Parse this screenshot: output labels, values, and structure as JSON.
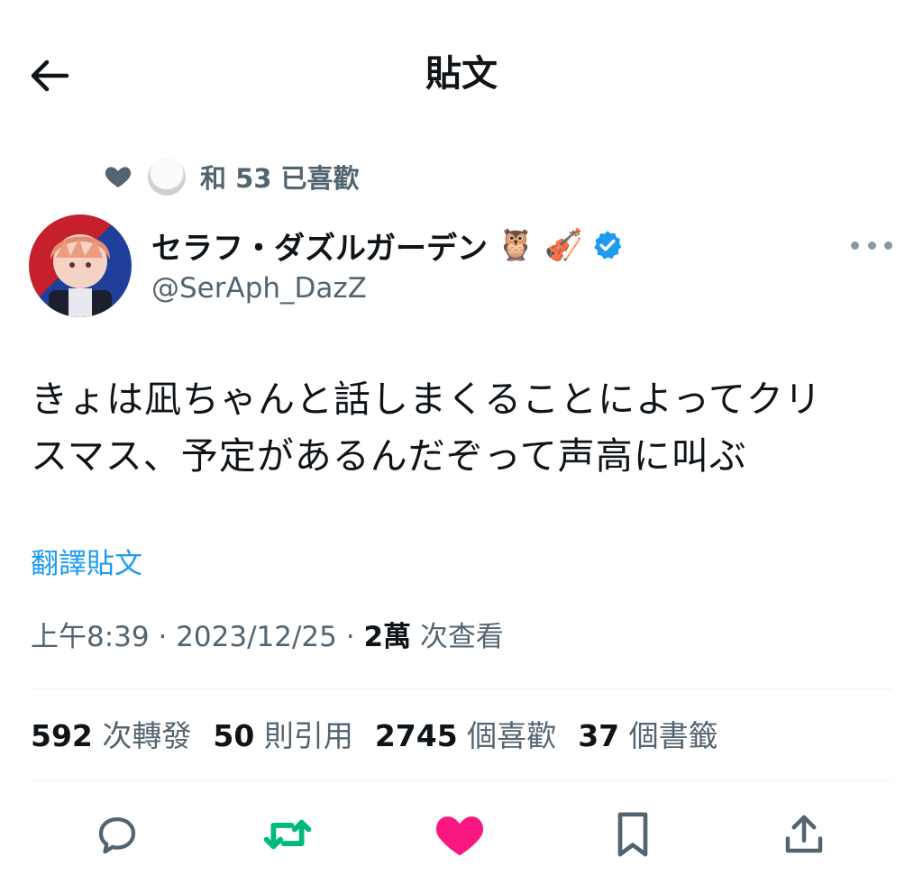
{
  "header": {
    "title": "貼文"
  },
  "social_context": {
    "text": "和 53 已喜歡"
  },
  "author": {
    "display_name": "セラフ・ダズルガーデン",
    "emojis": "🦉 🎻",
    "handle": "@SerAph_DazZ",
    "verified": true
  },
  "tweet": {
    "text_line1": "きょは凪ちゃんと話しまくることによってクリ",
    "text_line2": "スマス、予定があるんだぞって声高に叫ぶ",
    "translate_label": "翻譯貼文",
    "time": "上午8:39",
    "sep": " · ",
    "date": "2023/12/25",
    "views": "2萬",
    "views_label": " 次查看"
  },
  "stats": [
    {
      "num": "592",
      "label": " 次轉發"
    },
    {
      "num": "50",
      "label": " 則引用"
    },
    {
      "num": "2745",
      "label": " 個喜歡"
    },
    {
      "num": "37",
      "label": " 個書籤"
    }
  ],
  "colors": {
    "accent": "#1d9bf0",
    "retweet": "#00ba7c",
    "like": "#f91880",
    "muted": "#536471"
  },
  "icons": {
    "back": "arrow-left-icon",
    "reply": "reply-icon",
    "retweet": "retweet-icon",
    "like": "heart-icon",
    "bookmark": "bookmark-icon",
    "share": "share-icon"
  }
}
